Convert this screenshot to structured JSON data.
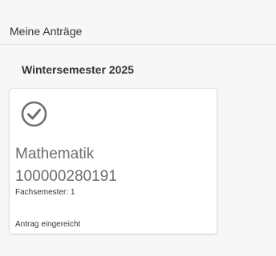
{
  "header": {
    "title": "Meine Anträge"
  },
  "section": {
    "title": "Wintersemester 2025"
  },
  "tiles": [
    {
      "icon": "check-circle-icon",
      "name": "Mathematik",
      "number": "100000280191",
      "subtitle": "Fachsemester: 1",
      "status": "Antrag eingereicht"
    }
  ],
  "colors": {
    "background": "#f7f7f7",
    "tile": "#ffffff",
    "icon": "#6a6d70",
    "text": "#32363a"
  }
}
